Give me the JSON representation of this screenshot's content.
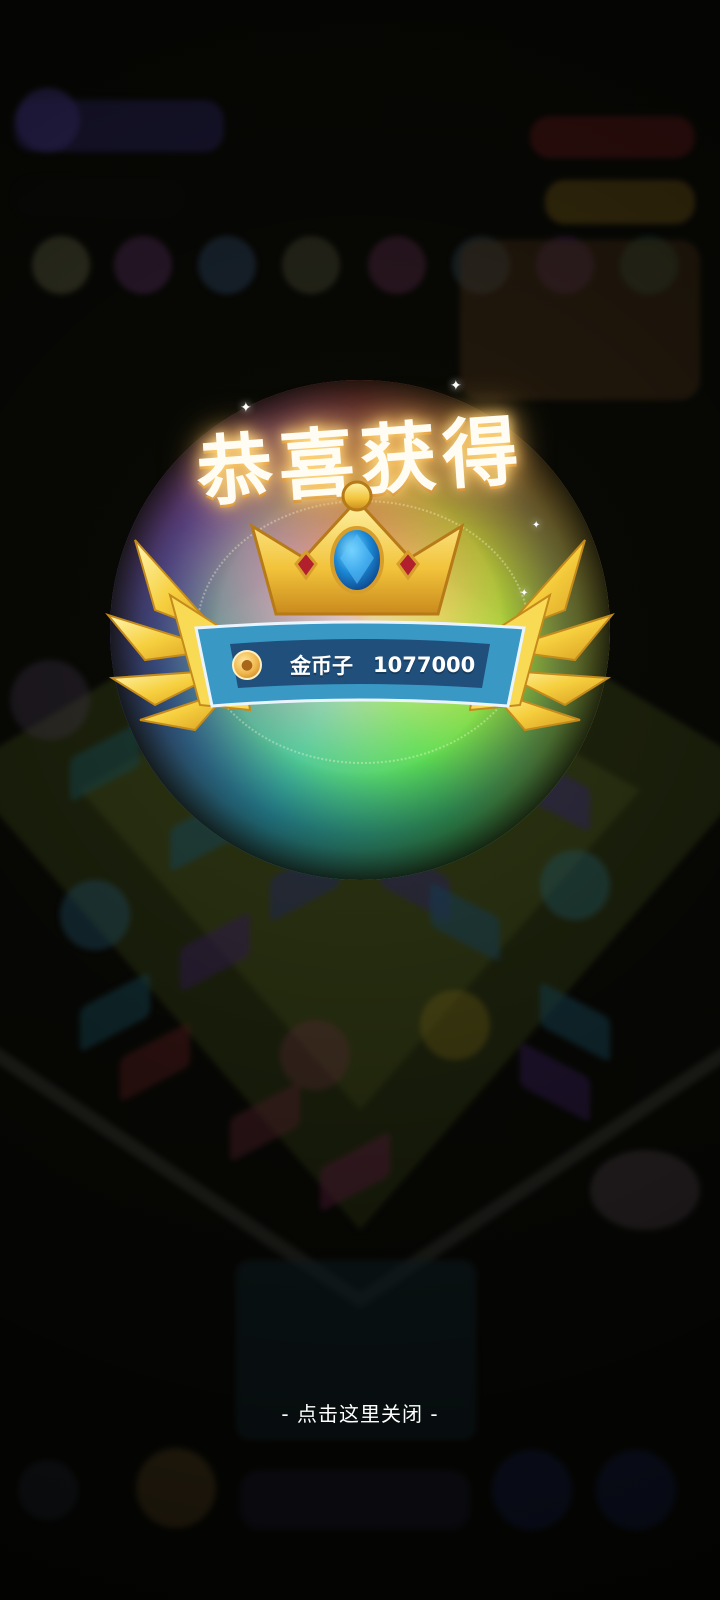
{
  "popup": {
    "title": "恭喜获得",
    "reward_name": "金币子",
    "reward_amount": "1077000",
    "close_hint": "- 点击这里关闭 -"
  },
  "icons": {
    "coin": "coin-icon",
    "crown": "crown-icon",
    "wings": "wings-icon"
  },
  "colors": {
    "banner": "#2f7fa8",
    "banner_inner": "#1f4f7a",
    "gold": "#f5c53a",
    "gem_blue": "#1d6bbf",
    "gem_red": "#b3202d",
    "title_glow": "#ffb64a"
  }
}
